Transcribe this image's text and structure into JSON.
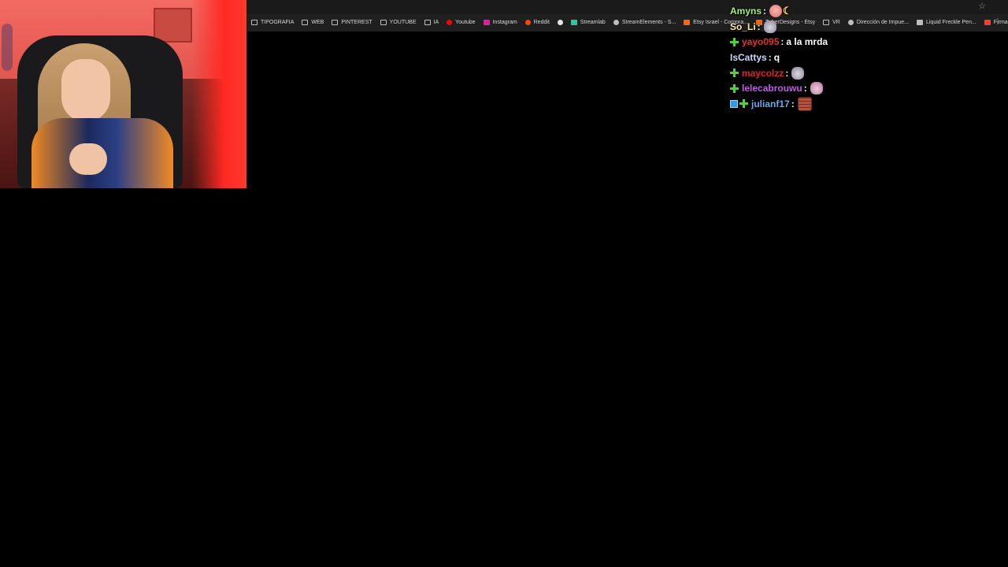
{
  "browser": {
    "bookmarks": [
      {
        "label": "TIPOGRAFIA",
        "icon": "folder-icon",
        "color": "#bdbdbd"
      },
      {
        "label": "WEB",
        "icon": "folder-icon",
        "color": "#bdbdbd"
      },
      {
        "label": "PINTEREST",
        "icon": "folder-icon",
        "color": "#bdbdbd"
      },
      {
        "label": "YOUTUBE",
        "icon": "folder-icon",
        "color": "#bdbdbd"
      },
      {
        "label": "IA",
        "icon": "folder-icon",
        "color": "#bdbdbd"
      },
      {
        "label": "Youtube",
        "icon": "youtube-icon",
        "color": "#ff0000"
      },
      {
        "label": "Instagram",
        "icon": "instagram-icon",
        "color": "#d6249f"
      },
      {
        "label": "Reddit",
        "icon": "reddit-icon",
        "color": "#ff4500"
      },
      {
        "label": "",
        "icon": "github-icon",
        "color": "#e6e6e6"
      },
      {
        "label": "Streamlab",
        "icon": "streamlabs-icon",
        "color": "#31c3a2"
      },
      {
        "label": "StreamElements - S...",
        "icon": "streamelements-icon",
        "color": "#bdbdbd"
      },
      {
        "label": "Etsy Israel - Compra...",
        "icon": "etsy-icon",
        "color": "#f1641e"
      },
      {
        "label": "TuberDesigns - Etsy",
        "icon": "etsy-icon",
        "color": "#f1641e"
      },
      {
        "label": "VR",
        "icon": "folder-icon",
        "color": "#bdbdbd"
      },
      {
        "label": "Dirección de Impue...",
        "icon": "globe-icon",
        "color": "#bdbdbd"
      },
      {
        "label": "Liquid Freckle Pen...",
        "icon": "page-icon",
        "color": "#bdbdbd"
      },
      {
        "label": "Firma del Certificad...",
        "icon": "gmail-icon",
        "color": "#ea4335"
      }
    ],
    "star_icon": "star-icon",
    "menu_icon": "more-icon"
  },
  "chat": {
    "messages": [
      {
        "badges": [],
        "username": "Amyns",
        "user_color": "#a6f07a",
        "message": "",
        "emotes": [
          "pig-emote",
          "moon-emote"
        ]
      },
      {
        "badges": [],
        "username": "So_Li",
        "user_color": "#ffe9a8",
        "message": "",
        "emotes": [
          "mouse-emote"
        ]
      },
      {
        "badges": [
          "plus-badge"
        ],
        "username": "yayo095",
        "user_color": "#e0312f",
        "message": "a la mrda",
        "emotes": []
      },
      {
        "badges": [],
        "username": "IsCattys",
        "user_color": "#cdd7ff",
        "message": "q",
        "emotes": []
      },
      {
        "badges": [
          "plus-badge"
        ],
        "username": "maycolzz",
        "user_color": "#e0222a",
        "message": "",
        "emotes": [
          "mouse-emote"
        ]
      },
      {
        "badges": [
          "plus-badge"
        ],
        "username": "lelecabrouwu",
        "user_color": "#c05ce6",
        "message": "",
        "emotes": [
          "mouse-pink-emote"
        ]
      },
      {
        "badges": [
          "prime-badge",
          "plus-badge"
        ],
        "username": "julianf17",
        "user_color": "#6aa8e8",
        "message": "",
        "emotes": [
          "bricks-emote"
        ]
      }
    ],
    "separator": ":"
  }
}
